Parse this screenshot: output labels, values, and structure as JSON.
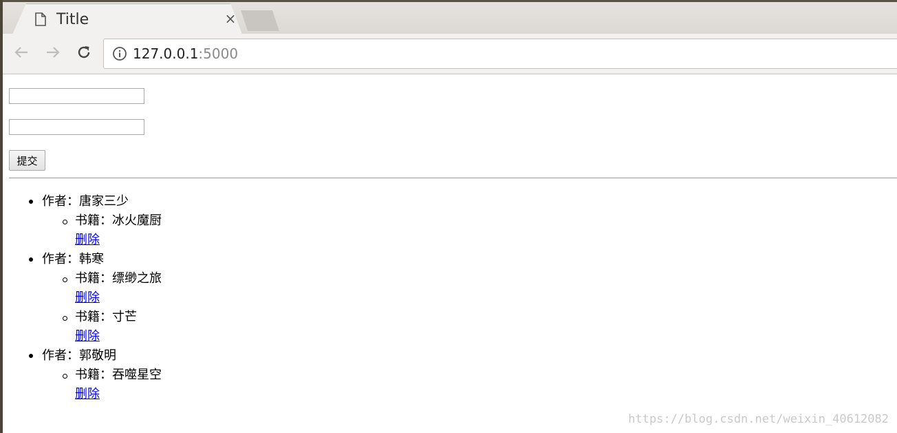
{
  "browser": {
    "tab": {
      "title": "Title",
      "close_label": "×",
      "icon": "page-icon"
    },
    "url_host": "127.0.0.1",
    "url_port": ":5000",
    "icons": {
      "back": "arrow-left-icon",
      "forward": "arrow-right-icon",
      "reload": "reload-icon",
      "info": "info-icon"
    }
  },
  "form": {
    "input1_value": "",
    "input2_value": "",
    "submit_label": "提交"
  },
  "authors": [
    {
      "label": "作者：唐家三少",
      "books": [
        {
          "label": "书籍：冰火魔厨",
          "delete_label": "删除"
        }
      ]
    },
    {
      "label": "作者：韩寒",
      "books": [
        {
          "label": "书籍：缥缈之旅",
          "delete_label": "删除"
        },
        {
          "label": "书籍：寸芒",
          "delete_label": "删除"
        }
      ]
    },
    {
      "label": "作者：郭敬明",
      "books": [
        {
          "label": "书籍：吞噬星空",
          "delete_label": "删除"
        }
      ]
    }
  ],
  "watermark": "https://blog.csdn.net/weixin_40612082",
  "colors": {
    "link": "#0000ee",
    "tab_bar": "#e6e3df",
    "toolbar": "#f2f1f0"
  }
}
